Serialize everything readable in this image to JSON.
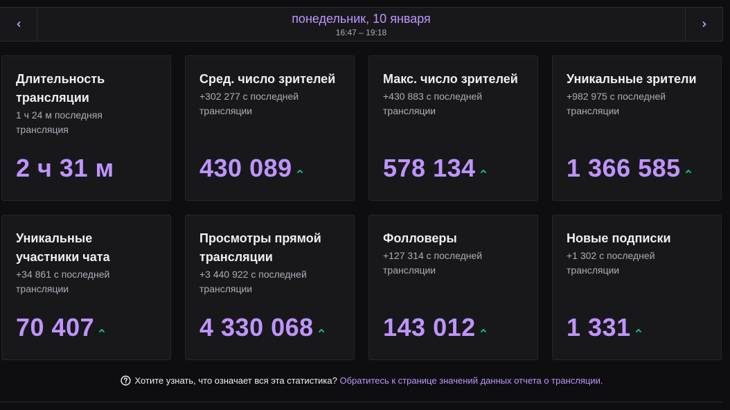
{
  "header": {
    "date": "понедельник, 10 января",
    "time_range": "16:47 – 19:18",
    "prev_icon": "chevron-left-icon",
    "next_icon": "chevron-right-icon"
  },
  "colors": {
    "accent": "#bf94ff",
    "trend_up": "#00d68f",
    "card_bg": "#18181b",
    "page_bg": "#0e0e10"
  },
  "cards": [
    {
      "title": "Длительность трансляции",
      "subtitle": "1 ч 24 м последняя трансляция",
      "value": "2 ч 31 м",
      "trend": "none"
    },
    {
      "title": "Сред. число зрителей",
      "subtitle": "+302 277 с последней трансляции",
      "value": "430 089",
      "trend": "up"
    },
    {
      "title": "Макс. число зрителей",
      "subtitle": "+430 883 с последней трансляции",
      "value": "578 134",
      "trend": "up"
    },
    {
      "title": "Уникальные зрители",
      "subtitle": "+982 975 с последней трансляции",
      "value": "1 366 585",
      "trend": "up"
    },
    {
      "title": "Уникальные участники чата",
      "subtitle": "+34 861 с последней трансляции",
      "value": "70 407",
      "trend": "up"
    },
    {
      "title": "Просмотры прямой трансляции",
      "subtitle": "+3 440 922 с последней трансляции",
      "value": "4 330 068",
      "trend": "up"
    },
    {
      "title": "Фолловеры",
      "subtitle": "+127 314 с последней трансляции",
      "value": "143 012",
      "trend": "up"
    },
    {
      "title": "Новые подписки",
      "subtitle": "+1 302 с последней трансляции",
      "value": "1 331",
      "trend": "up"
    }
  ],
  "footer": {
    "icon": "help-circle-icon",
    "question": "Хотите узнать, что означает вся эта статистика?",
    "link": "Обратитесь к странице значений данных отчета о трансляции."
  }
}
